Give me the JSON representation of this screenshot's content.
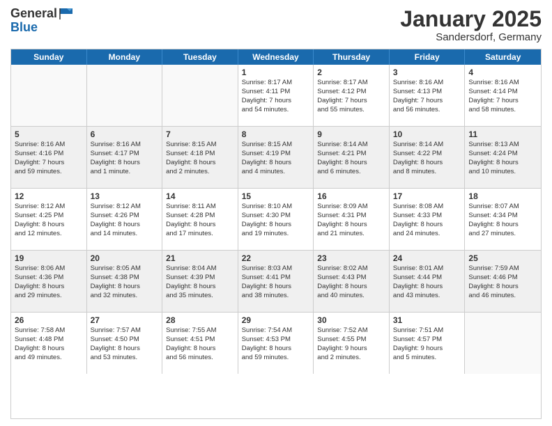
{
  "header": {
    "logo_general": "General",
    "logo_blue": "Blue",
    "month_year": "January 2025",
    "location": "Sandersdorf, Germany"
  },
  "weekdays": [
    "Sunday",
    "Monday",
    "Tuesday",
    "Wednesday",
    "Thursday",
    "Friday",
    "Saturday"
  ],
  "rows": [
    {
      "alt": false,
      "cells": [
        {
          "day": "",
          "info": ""
        },
        {
          "day": "",
          "info": ""
        },
        {
          "day": "",
          "info": ""
        },
        {
          "day": "1",
          "info": "Sunrise: 8:17 AM\nSunset: 4:11 PM\nDaylight: 7 hours\nand 54 minutes."
        },
        {
          "day": "2",
          "info": "Sunrise: 8:17 AM\nSunset: 4:12 PM\nDaylight: 7 hours\nand 55 minutes."
        },
        {
          "day": "3",
          "info": "Sunrise: 8:16 AM\nSunset: 4:13 PM\nDaylight: 7 hours\nand 56 minutes."
        },
        {
          "day": "4",
          "info": "Sunrise: 8:16 AM\nSunset: 4:14 PM\nDaylight: 7 hours\nand 58 minutes."
        }
      ]
    },
    {
      "alt": true,
      "cells": [
        {
          "day": "5",
          "info": "Sunrise: 8:16 AM\nSunset: 4:16 PM\nDaylight: 7 hours\nand 59 minutes."
        },
        {
          "day": "6",
          "info": "Sunrise: 8:16 AM\nSunset: 4:17 PM\nDaylight: 8 hours\nand 1 minute."
        },
        {
          "day": "7",
          "info": "Sunrise: 8:15 AM\nSunset: 4:18 PM\nDaylight: 8 hours\nand 2 minutes."
        },
        {
          "day": "8",
          "info": "Sunrise: 8:15 AM\nSunset: 4:19 PM\nDaylight: 8 hours\nand 4 minutes."
        },
        {
          "day": "9",
          "info": "Sunrise: 8:14 AM\nSunset: 4:21 PM\nDaylight: 8 hours\nand 6 minutes."
        },
        {
          "day": "10",
          "info": "Sunrise: 8:14 AM\nSunset: 4:22 PM\nDaylight: 8 hours\nand 8 minutes."
        },
        {
          "day": "11",
          "info": "Sunrise: 8:13 AM\nSunset: 4:24 PM\nDaylight: 8 hours\nand 10 minutes."
        }
      ]
    },
    {
      "alt": false,
      "cells": [
        {
          "day": "12",
          "info": "Sunrise: 8:12 AM\nSunset: 4:25 PM\nDaylight: 8 hours\nand 12 minutes."
        },
        {
          "day": "13",
          "info": "Sunrise: 8:12 AM\nSunset: 4:26 PM\nDaylight: 8 hours\nand 14 minutes."
        },
        {
          "day": "14",
          "info": "Sunrise: 8:11 AM\nSunset: 4:28 PM\nDaylight: 8 hours\nand 17 minutes."
        },
        {
          "day": "15",
          "info": "Sunrise: 8:10 AM\nSunset: 4:30 PM\nDaylight: 8 hours\nand 19 minutes."
        },
        {
          "day": "16",
          "info": "Sunrise: 8:09 AM\nSunset: 4:31 PM\nDaylight: 8 hours\nand 21 minutes."
        },
        {
          "day": "17",
          "info": "Sunrise: 8:08 AM\nSunset: 4:33 PM\nDaylight: 8 hours\nand 24 minutes."
        },
        {
          "day": "18",
          "info": "Sunrise: 8:07 AM\nSunset: 4:34 PM\nDaylight: 8 hours\nand 27 minutes."
        }
      ]
    },
    {
      "alt": true,
      "cells": [
        {
          "day": "19",
          "info": "Sunrise: 8:06 AM\nSunset: 4:36 PM\nDaylight: 8 hours\nand 29 minutes."
        },
        {
          "day": "20",
          "info": "Sunrise: 8:05 AM\nSunset: 4:38 PM\nDaylight: 8 hours\nand 32 minutes."
        },
        {
          "day": "21",
          "info": "Sunrise: 8:04 AM\nSunset: 4:39 PM\nDaylight: 8 hours\nand 35 minutes."
        },
        {
          "day": "22",
          "info": "Sunrise: 8:03 AM\nSunset: 4:41 PM\nDaylight: 8 hours\nand 38 minutes."
        },
        {
          "day": "23",
          "info": "Sunrise: 8:02 AM\nSunset: 4:43 PM\nDaylight: 8 hours\nand 40 minutes."
        },
        {
          "day": "24",
          "info": "Sunrise: 8:01 AM\nSunset: 4:44 PM\nDaylight: 8 hours\nand 43 minutes."
        },
        {
          "day": "25",
          "info": "Sunrise: 7:59 AM\nSunset: 4:46 PM\nDaylight: 8 hours\nand 46 minutes."
        }
      ]
    },
    {
      "alt": false,
      "cells": [
        {
          "day": "26",
          "info": "Sunrise: 7:58 AM\nSunset: 4:48 PM\nDaylight: 8 hours\nand 49 minutes."
        },
        {
          "day": "27",
          "info": "Sunrise: 7:57 AM\nSunset: 4:50 PM\nDaylight: 8 hours\nand 53 minutes."
        },
        {
          "day": "28",
          "info": "Sunrise: 7:55 AM\nSunset: 4:51 PM\nDaylight: 8 hours\nand 56 minutes."
        },
        {
          "day": "29",
          "info": "Sunrise: 7:54 AM\nSunset: 4:53 PM\nDaylight: 8 hours\nand 59 minutes."
        },
        {
          "day": "30",
          "info": "Sunrise: 7:52 AM\nSunset: 4:55 PM\nDaylight: 9 hours\nand 2 minutes."
        },
        {
          "day": "31",
          "info": "Sunrise: 7:51 AM\nSunset: 4:57 PM\nDaylight: 9 hours\nand 5 minutes."
        },
        {
          "day": "",
          "info": ""
        }
      ]
    }
  ]
}
